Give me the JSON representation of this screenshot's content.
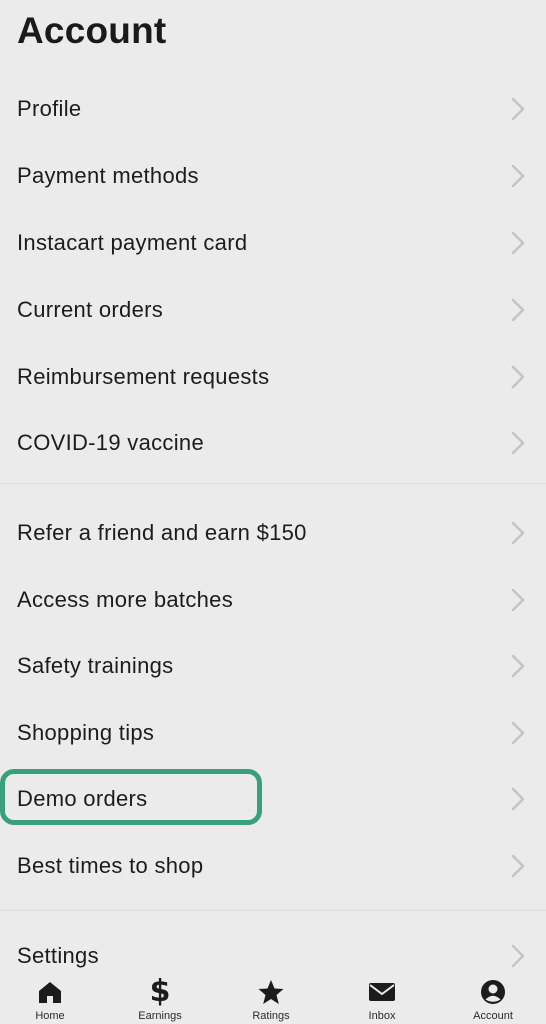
{
  "header": {
    "title": "Account"
  },
  "menu": {
    "items": [
      {
        "label": "Profile"
      },
      {
        "label": "Payment methods"
      },
      {
        "label": "Instacart payment card"
      },
      {
        "label": "Current orders"
      },
      {
        "label": "Reimbursement requests"
      },
      {
        "label": "COVID-19 vaccine"
      },
      {
        "label": "Refer a friend and earn $150"
      },
      {
        "label": "Access more batches"
      },
      {
        "label": "Safety trainings"
      },
      {
        "label": "Shopping tips"
      },
      {
        "label": "Demo orders",
        "highlighted": true
      },
      {
        "label": "Best times to shop"
      },
      {
        "label": "Settings"
      }
    ]
  },
  "tabbar": {
    "tabs": [
      {
        "label": "Home",
        "icon": "home-icon"
      },
      {
        "label": "Earnings",
        "icon": "dollar-icon"
      },
      {
        "label": "Ratings",
        "icon": "star-icon"
      },
      {
        "label": "Inbox",
        "icon": "mail-icon"
      },
      {
        "label": "Account",
        "icon": "account-icon",
        "active": true
      }
    ]
  },
  "colors": {
    "background": "#ebebeb",
    "highlight": "#3aa07c",
    "text": "#1c1c1c",
    "chevron": "#c4c4c4"
  }
}
